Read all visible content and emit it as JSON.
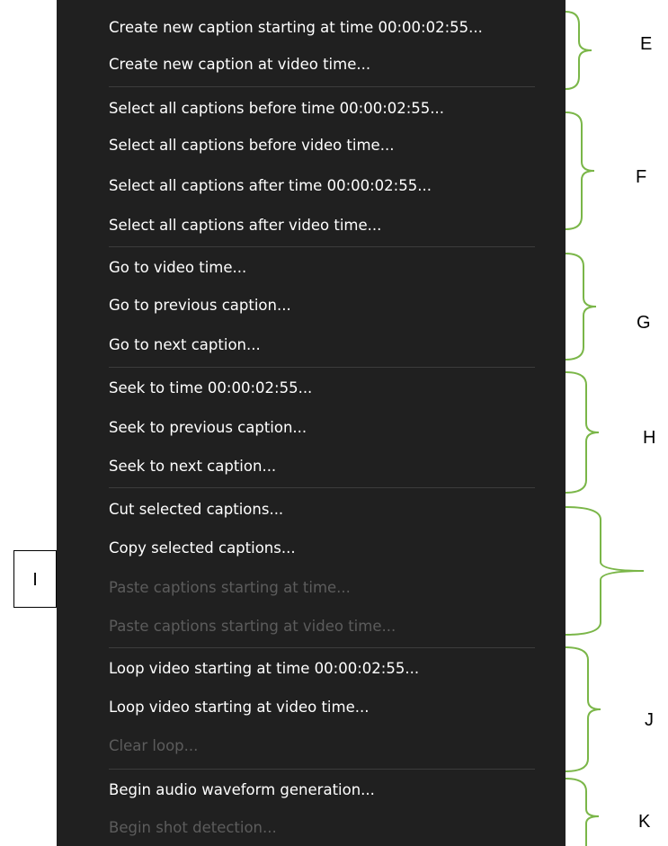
{
  "menu": {
    "items": [
      {
        "label": "Create new caption starting at time 00:00:02:55...",
        "enabled": true
      },
      {
        "label": "Create new caption at video time...",
        "enabled": true
      },
      {
        "label": "Select all captions before time 00:00:02:55...",
        "enabled": true
      },
      {
        "label": "Select all captions before video time...",
        "enabled": true
      },
      {
        "label": "Select all captions after time 00:00:02:55...",
        "enabled": true
      },
      {
        "label": "Select all captions after video time...",
        "enabled": true
      },
      {
        "label": "Go to video time...",
        "enabled": true
      },
      {
        "label": "Go to previous caption...",
        "enabled": true
      },
      {
        "label": "Go to next caption...",
        "enabled": true
      },
      {
        "label": "Seek to time 00:00:02:55...",
        "enabled": true
      },
      {
        "label": "Seek to previous caption...",
        "enabled": true
      },
      {
        "label": "Seek to next caption...",
        "enabled": true
      },
      {
        "label": "Cut selected captions...",
        "enabled": true
      },
      {
        "label": "Copy selected captions...",
        "enabled": true
      },
      {
        "label": "Paste captions starting at time...",
        "enabled": false
      },
      {
        "label": "Paste captions starting at video time...",
        "enabled": false
      },
      {
        "label": "Loop video starting at time 00:00:02:55...",
        "enabled": true
      },
      {
        "label": "Loop video starting at video time...",
        "enabled": true
      },
      {
        "label": "Clear loop...",
        "enabled": false
      },
      {
        "label": "Begin audio waveform generation...",
        "enabled": true
      },
      {
        "label": "Begin shot detection...",
        "enabled": false
      }
    ]
  },
  "annotations": {
    "group_labels": [
      "E",
      "F",
      "G",
      "H",
      "J",
      "K"
    ],
    "callout": "I",
    "brace_color": "#7ab648"
  },
  "colors": {
    "menu_background": "#202020",
    "enabled_text": "#ffffff",
    "disabled_text": "#5c5c5c",
    "separator": "#3c3c3c"
  }
}
